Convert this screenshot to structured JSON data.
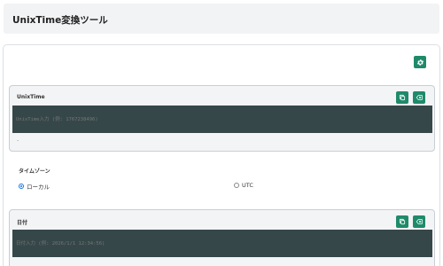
{
  "header": {
    "title": "UnixTime変換ツール"
  },
  "settings": {
    "icon": "gear-icon"
  },
  "unix_panel": {
    "label": "UnixTime",
    "placeholder": "UnixTime入力 (例: 1767238496)",
    "result": "-",
    "copy_icon": "copy-icon",
    "clear_icon": "backspace-icon"
  },
  "timezone": {
    "label": "タイムゾーン",
    "options": [
      {
        "label": "ローカル",
        "selected": true
      },
      {
        "label": "UTC",
        "selected": false
      }
    ]
  },
  "date_panel": {
    "label": "日付",
    "placeholder": "日付入力 (例: 2026/1/1 12:34:56)",
    "copy_icon": "copy-icon",
    "clear_icon": "backspace-icon"
  },
  "colors": {
    "accent": "#1f8a6a",
    "input_bg": "#36474a",
    "radio": "#1a73e8"
  }
}
